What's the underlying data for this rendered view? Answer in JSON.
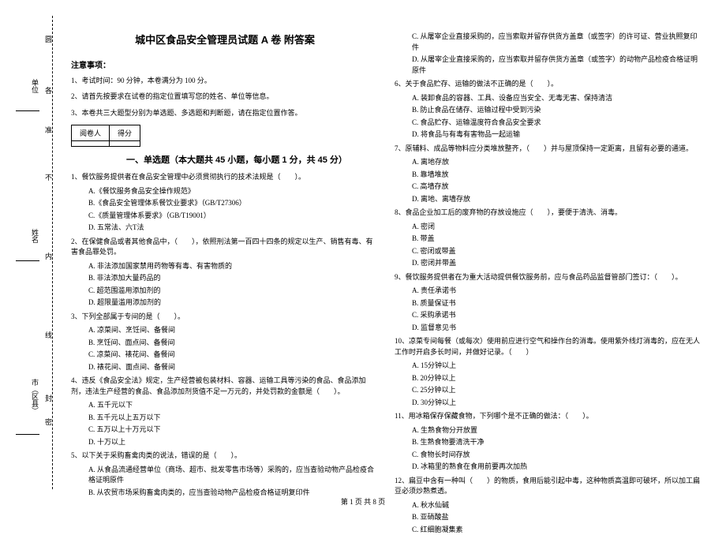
{
  "margin": {
    "top_marker": "圆",
    "top_marker2": "各",
    "top_marker3": "准",
    "bottom_marker": "密",
    "label1": "单位",
    "label2": "姓名",
    "label3": "市（区县）",
    "cut1": "不",
    "cut2": "内",
    "cut3": "线",
    "cut4": "封"
  },
  "title": "城中区食品安全管理员试题 A 卷  附答案",
  "notice": {
    "heading": "注意事项：",
    "items": [
      "1、考试时间：90 分钟，本卷满分为 100 分。",
      "2、请首先按要求在试卷的指定位置填写您的姓名、单位等信息。",
      "3、本卷共三大题型分别为单选题、多选题和判断题，请在指定位置作答。"
    ]
  },
  "scoreTable": {
    "r1c1": "阅卷人",
    "r1c2": "得分",
    "r2c1": "",
    "r2c2": ""
  },
  "section1": {
    "title": "一、单选题（本大题共 45 小题，每小题 1 分，共 45 分）",
    "q1": {
      "stem": "1、餐饮服务提供者在食品安全管理中必须贯彻执行的技术法规是（　　）。",
      "a": "A.《餐饮服务食品安全操作规范》",
      "b": "B.《食品安全管理体系餐饮业要求》（GB/T27306）",
      "c": "C.《质量管理体系要求》（GB/T19001）",
      "d": "D. 五常法、六T法"
    },
    "q2": {
      "stem": "2、在保健食品或者其他食品中，（　　），依照刑法第一百四十四条的规定以生产、销售有毒、有害食品罪处罚。",
      "a": "A. 非法添加国家禁用药物等有毒、有害物质的",
      "b": "B. 非法添加大量药品的",
      "c": "C. 超范围滥用添加剂的",
      "d": "D. 超限量滥用添加剂的"
    },
    "q3": {
      "stem": "3、下列全部属于专间的是（　　）。",
      "a": "A. 凉菜间、烹饪间、备餐间",
      "b": "B. 烹饪间、面点间、备餐间",
      "c": "C. 凉菜间、裱花间、备餐间",
      "d": "D. 裱花间、面点间、备餐间"
    },
    "q4": {
      "stem": "4、违反《食品安全法》规定，生产经营被包装材料、容器、运输工具等污染的食品、食品添加剂，违法生产经营的食品、食品添加剂货值不足一万元的，并处罚款的金额是（　　）。",
      "a": "A. 五千元以下",
      "b": "B. 五千元以上五万以下",
      "c": "C. 五万以上十万元以下",
      "d": "D. 十万以上"
    },
    "q5": {
      "stem": "5、以下关于采购畜禽肉类的说法，错误的是（　　）。",
      "a": "A. 从食品流通经营单位（商场、超市、批发零售市场等）采购的，应当查验动物产品检疫合格证明原件",
      "b": "B. 从农贸市场采购畜禽肉类的，应当查验动物产品检疫合格证明复印件"
    }
  },
  "col2": {
    "q5cd": {
      "c": "C. 从屠宰企业直接采购的，应当索取并留存供货方盖章（或签字）的许可证、营业执照复印件",
      "d": "D. 从屠宰企业直接采购的，应当索取并留存供货方盖章（或签字）的动物产品检疫合格证明原件"
    },
    "q6": {
      "stem": "6、关于食品贮存、运输的做法不正确的是（　　）。",
      "a": "A. 装卸食品的容器、工具、设备应当安全、无毒无害、保持清洁",
      "b": "B. 防止食品在储存、运输过程中受到污染",
      "c": "C. 食品贮存、运输温度符合食品安全要求",
      "d": "D. 将食品与有毒有害物品一起运输"
    },
    "q7": {
      "stem": "7、原辅料、成品等物料应分类堆放整齐，（　　）并与屋顶保持一定距离，且留有必要的通道。",
      "a": "A. 离地存放",
      "b": "B. 靠墙堆放",
      "c": "C. 高墙存放",
      "d": "D. 离地、离墙存放"
    },
    "q8": {
      "stem": "8、食品企业加工后的废弃物的存放设施应（　　），要便于清洗、消毒。",
      "a": "A. 密闭",
      "b": "B. 带盖",
      "c": "C. 密闭或带盖",
      "d": "D. 密闭并带盖"
    },
    "q9": {
      "stem": "9、餐饮服务提供者在为重大活动提供餐饮服务前，应与食品药品监督管部门签订：（　　）。",
      "a": "A. 责任承诺书",
      "b": "B. 质量保证书",
      "c": "C. 采购承诺书",
      "d": "D. 监督意见书"
    },
    "q10": {
      "stem": "10、凉菜专间每餐（或每次）使用前应进行空气和操作台的消毒。使用紫外线灯消毒的，应在无人工作时开启多长时间，并做好记录。（　　）",
      "a": "A. 15分钟以上",
      "b": "B. 20分钟以上",
      "c": "C. 25分钟以上",
      "d": "D. 30分钟以上"
    },
    "q11": {
      "stem": "11、用冰箱保存保藏食物，下列哪个是不正确的做法：（　　）。",
      "a": "A. 生熟食物分开放置",
      "b": "B. 生熟食物要清洗干净",
      "c": "C. 食物长时间存放",
      "d": "D. 冰箱里的熟食在食用前要再次加热"
    },
    "q12": {
      "stem": "12、扁豆中含有一种叫（　　）的物质，食用后能引起中毒，这种物质高温即可破坏，所以加工扁豆必须炒熟煮透。",
      "a": "A. 秋水仙碱",
      "b": "B. 亚硝酸盐",
      "c": "C. 红细胞凝集素"
    }
  },
  "footer": "第 1 页 共 8 页"
}
